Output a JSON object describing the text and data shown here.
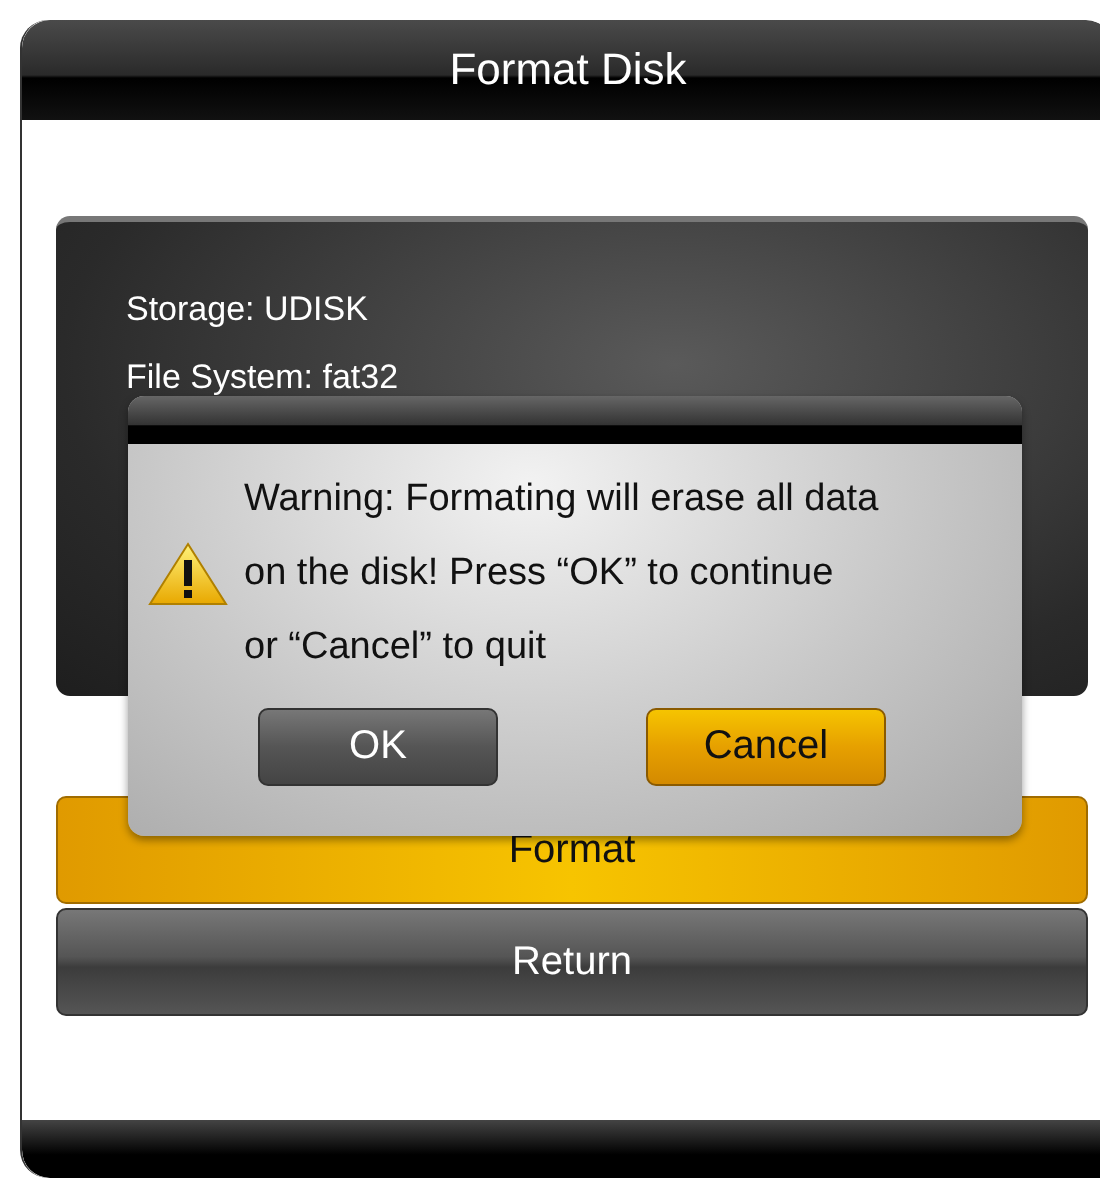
{
  "window": {
    "title": "Format Disk"
  },
  "info": [
    "Storage: UDISK",
    "File System: fat32"
  ],
  "actions": [
    {
      "label": "Format",
      "selected": true
    },
    {
      "label": "Return",
      "selected": false
    }
  ],
  "dialog": {
    "message_lines": [
      "Warning: Formating will erase all data",
      "on the disk! Press “OK” to continue",
      "or “Cancel” to quit"
    ],
    "buttons": [
      {
        "label": "OK",
        "selected": false
      },
      {
        "label": "Cancel",
        "selected": true
      }
    ]
  }
}
